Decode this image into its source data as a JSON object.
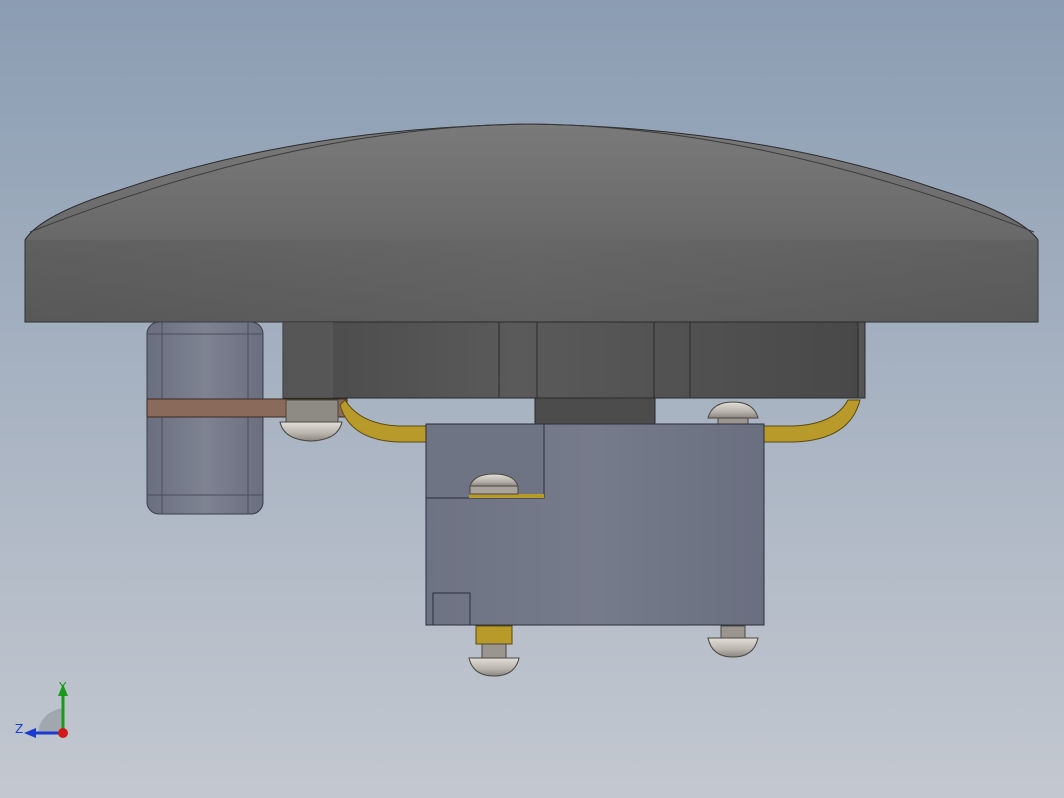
{
  "viewport": {
    "background_top": "#8b9db3",
    "background_bottom": "#c3c8d0"
  },
  "model": {
    "cap_color": "#6b6b6b",
    "body_color": "#5a5a5a",
    "housing_color": "#737887",
    "clip_color": "#7a7f8f",
    "strap_color": "#8a6a5a",
    "wire_color": "#b89a2a",
    "screw_color": "#c8c4bc"
  },
  "triad": {
    "y_label": "Y",
    "z_label": "Z",
    "y_color": "#1a9a1a",
    "z_color": "#1a3ad0",
    "origin_color": "#d01a1a"
  }
}
